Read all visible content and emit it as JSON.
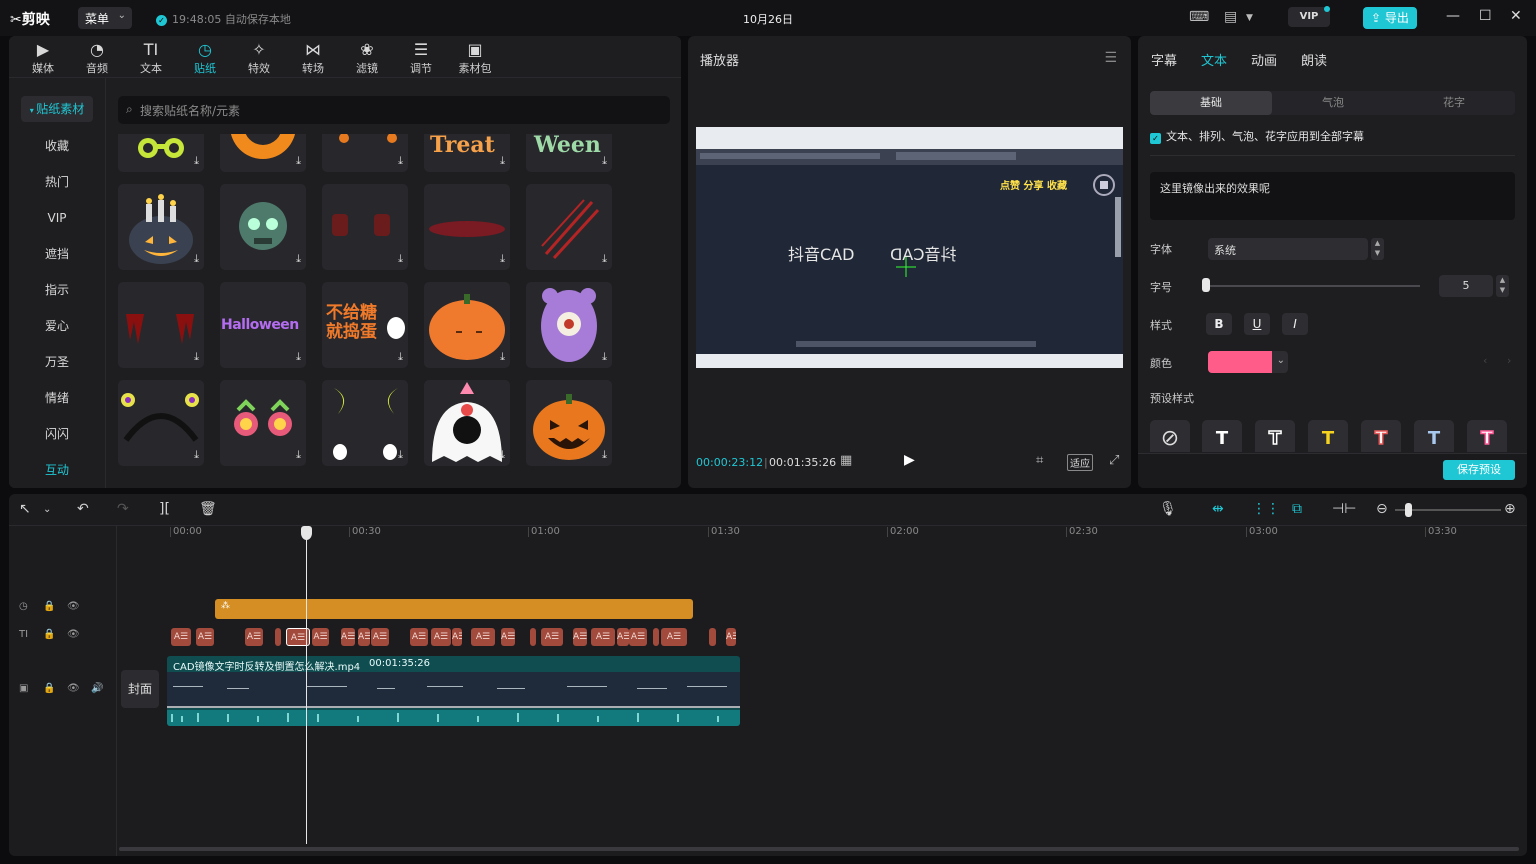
{
  "app": {
    "name": "剪映",
    "menu_label": "菜单",
    "save_status": "19:48:05 自动保存本地",
    "project_title": "10月26日",
    "vip_label": "VIP",
    "export_label": "导出"
  },
  "media": {
    "categories": [
      {
        "label": "媒体",
        "icon": "media-icon"
      },
      {
        "label": "音频",
        "icon": "audio-icon"
      },
      {
        "label": "文本",
        "icon": "text-icon"
      },
      {
        "label": "贴纸",
        "icon": "sticker-icon"
      },
      {
        "label": "特效",
        "icon": "effects-icon"
      },
      {
        "label": "转场",
        "icon": "transition-icon"
      },
      {
        "label": "滤镜",
        "icon": "filter-icon"
      },
      {
        "label": "调节",
        "icon": "adjust-icon"
      },
      {
        "label": "素材包",
        "icon": "package-icon"
      }
    ],
    "active_category": "贴纸",
    "sidebar": [
      "贴纸素材",
      "收藏",
      "热门",
      "VIP",
      "遮挡",
      "指示",
      "爱心",
      "万圣",
      "情绪",
      "闪闪",
      "互动"
    ],
    "search_placeholder": "搜索贴纸名称/元素",
    "sticker_texts": {
      "treat": "Treat",
      "ween": "Ween",
      "halloween": "Halloween",
      "tricktreat_cn": "不给糖就捣蛋"
    }
  },
  "player": {
    "title": "播放器",
    "video_text_left": "抖音CAD",
    "video_text_right": "抖音CAD",
    "video_overlay": "点赞 分享 收藏",
    "current_time": "00:00:23:12",
    "total_time": "00:01:35:26",
    "fit_label": "适应"
  },
  "props": {
    "tabs": [
      "字幕",
      "文本",
      "动画",
      "朗读"
    ],
    "active_tab": "文本",
    "subtabs": [
      "基础",
      "气泡",
      "花字"
    ],
    "apply_all_label": "文本、排列、气泡、花字应用到全部字幕",
    "text_content": "这里镜像出来的效果呢",
    "font_label": "字体",
    "font_value": "系统",
    "size_label": "字号",
    "size_value": "5",
    "style_label": "样式",
    "style_buttons": [
      "B",
      "U",
      "I"
    ],
    "color_label": "颜色",
    "color_value": "#ff5c8a",
    "preset_label": "预设样式",
    "save_preset_label": "保存预设"
  },
  "timeline": {
    "ruler_labels": [
      "00:00",
      "00:30",
      "01:00",
      "01:30",
      "02:00",
      "02:30",
      "03:00",
      "03:30"
    ],
    "cover_label": "封面",
    "video_clip_name": "CAD镜像文字时反转及倒置怎么解决.mp4",
    "video_clip_duration": "00:01:35:26",
    "text_clip_label": "A☰"
  }
}
